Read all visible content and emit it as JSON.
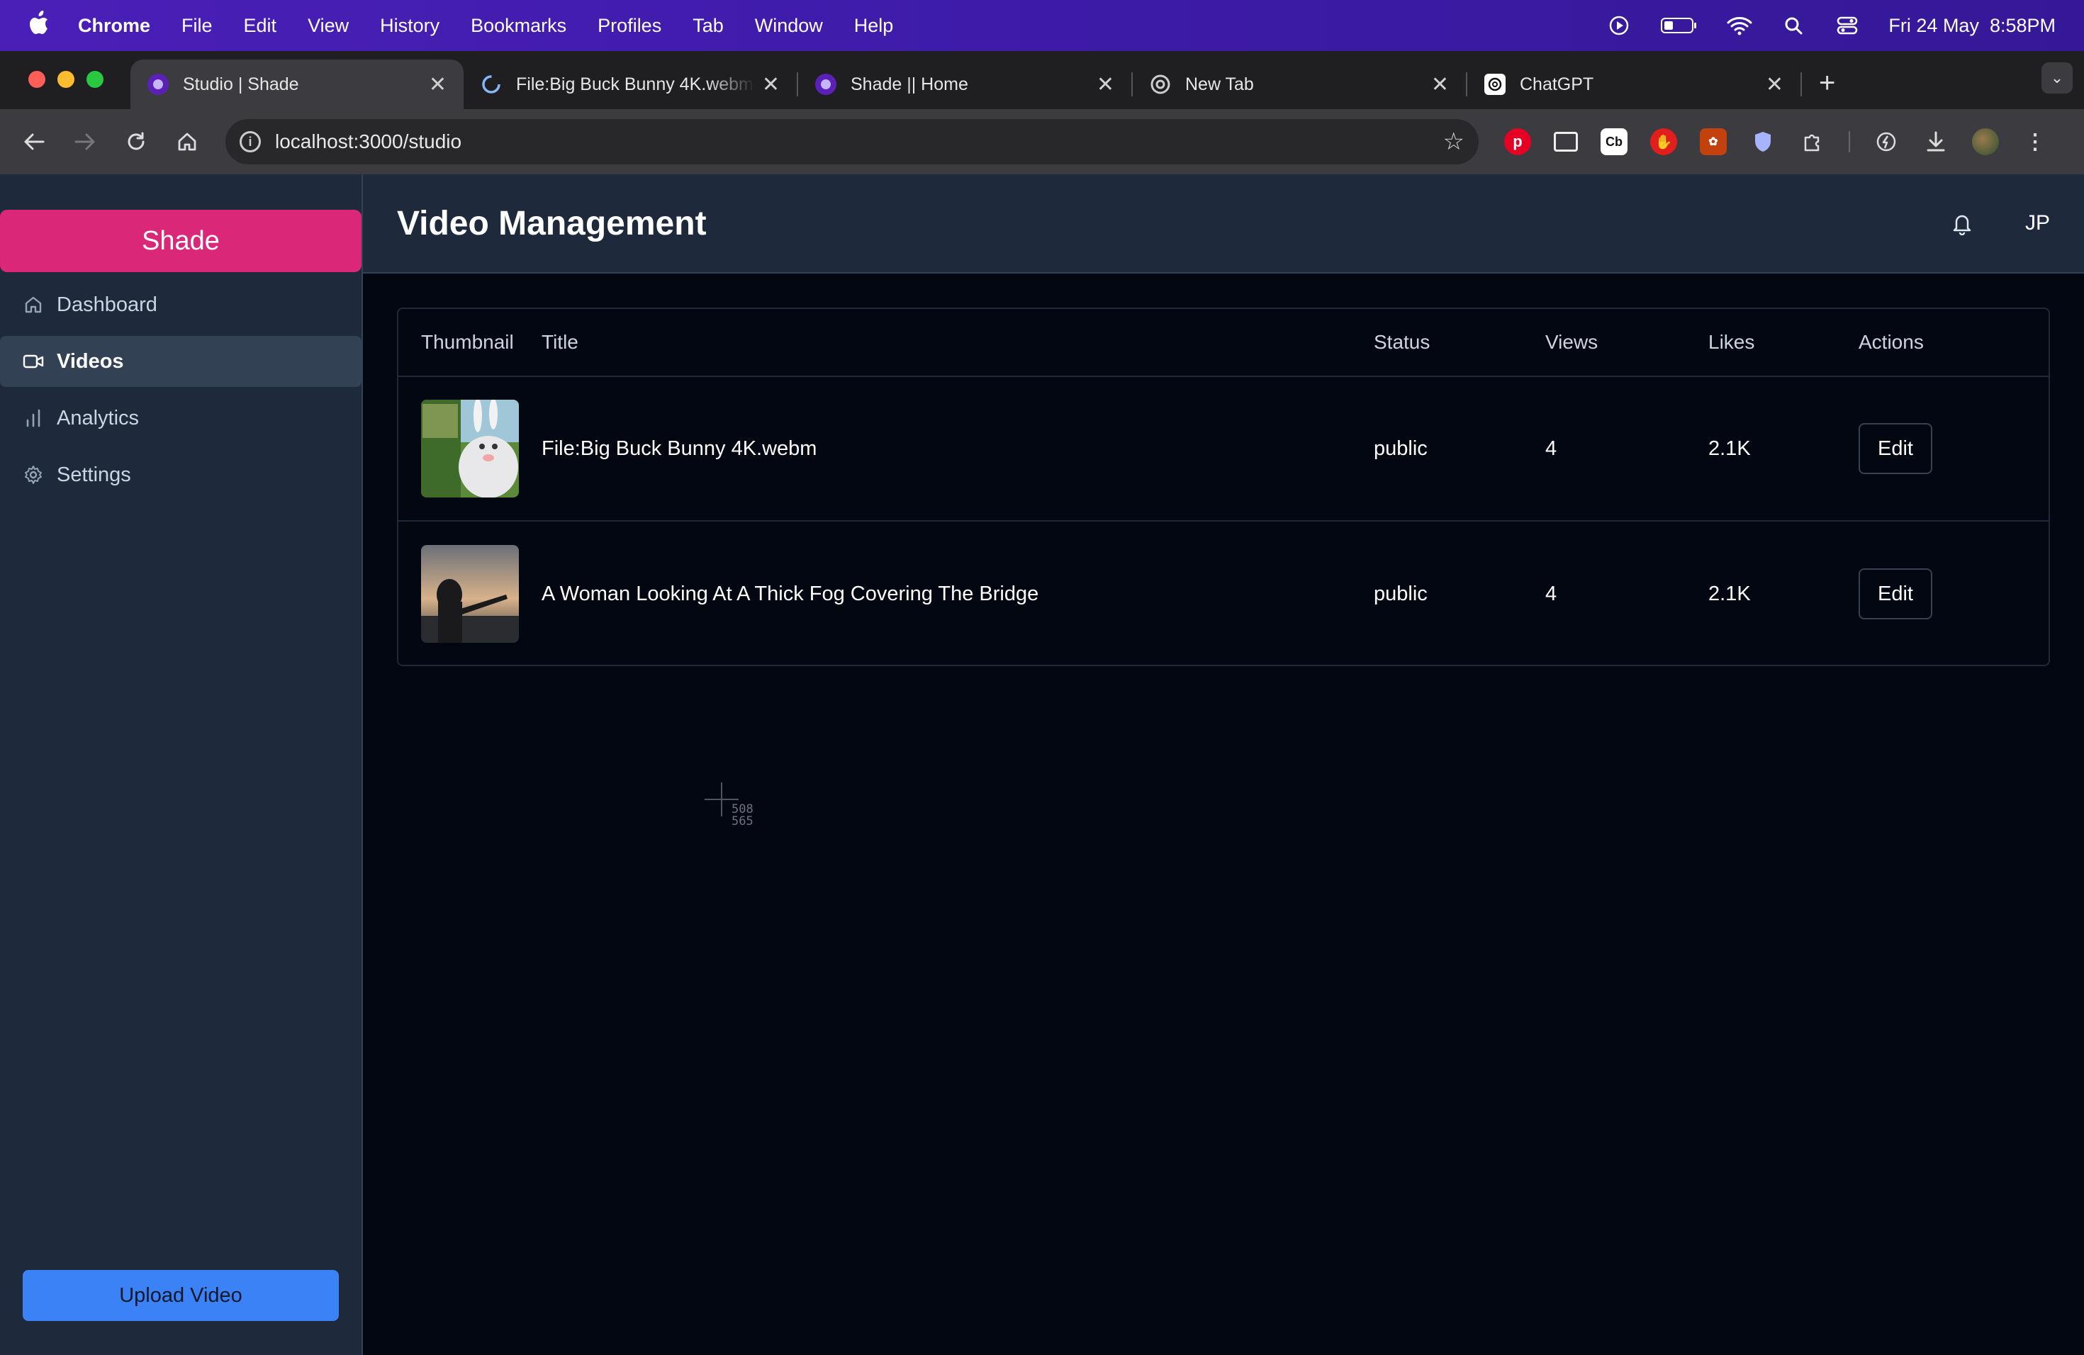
{
  "menubar": {
    "app_name": "Chrome",
    "items": [
      "File",
      "Edit",
      "View",
      "History",
      "Bookmarks",
      "Profiles",
      "Tab",
      "Window",
      "Help"
    ],
    "datetime": "Fri 24 May  8:58PM"
  },
  "tabs": [
    {
      "title": "Studio | Shade",
      "active": true,
      "icon": "shade-favicon"
    },
    {
      "title": "File:Big Buck Bunny 4K.webm",
      "active": false,
      "icon": "loading-favicon"
    },
    {
      "title": "Shade || Home",
      "active": false,
      "icon": "shade-favicon"
    },
    {
      "title": "New Tab",
      "active": false,
      "icon": "chrome-favicon"
    },
    {
      "title": "ChatGPT",
      "active": false,
      "icon": "chatgpt-favicon"
    }
  ],
  "address_bar": {
    "url": "localhost:3000/studio"
  },
  "sidebar": {
    "brand": "Shade",
    "items": [
      {
        "label": "Dashboard",
        "icon": "home-icon",
        "active": false
      },
      {
        "label": "Videos",
        "icon": "video-icon",
        "active": true
      },
      {
        "label": "Analytics",
        "icon": "bar-chart-icon",
        "active": false
      },
      {
        "label": "Settings",
        "icon": "gear-icon",
        "active": false
      }
    ],
    "upload_label": "Upload Video"
  },
  "header": {
    "title": "Video Management",
    "avatar_initials": "JP"
  },
  "table": {
    "columns": [
      "Thumbnail",
      "Title",
      "Status",
      "Views",
      "Likes",
      "Actions"
    ],
    "rows": [
      {
        "title": "File:Big Buck Bunny 4K.webm",
        "status": "public",
        "views": "4",
        "likes": "2.1K",
        "action": "Edit"
      },
      {
        "title": "A Woman Looking At A Thick Fog Covering The Bridge",
        "status": "public",
        "views": "4",
        "likes": "2.1K",
        "action": "Edit"
      }
    ]
  },
  "cursor_readout": {
    "x": "508",
    "y": "565"
  },
  "colors": {
    "brand": "#db2777",
    "upload_button": "#3b82f6",
    "sidebar_bg": "#1e293b",
    "page_bg": "#030712"
  }
}
